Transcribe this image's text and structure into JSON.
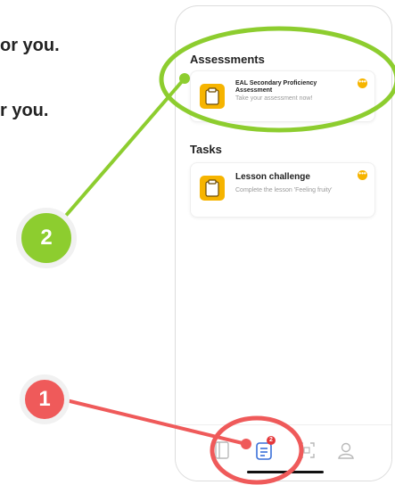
{
  "background": {
    "line1": "or you.",
    "line2": "r you."
  },
  "sections": {
    "assessments_title": "Assessments",
    "tasks_title": "Tasks"
  },
  "assessment_card": {
    "title": "EAL Secondary Proficiency Assessment",
    "subtitle": "Take your assessment now!",
    "more_icon": "ellipsis-icon"
  },
  "task_card": {
    "title": "Lesson challenge",
    "subtitle": "Complete the lesson 'Feeling fruity'",
    "more_icon": "ellipsis-icon"
  },
  "tabbar": {
    "tasks_badge": "2",
    "icons": [
      "book-icon",
      "tasks-icon",
      "scan-icon",
      "profile-icon"
    ]
  },
  "callouts": {
    "one": "1",
    "two": "2"
  },
  "colors": {
    "accent_yellow": "#f6b400",
    "callout_red": "#ef5a5a",
    "callout_green": "#8dcd2f",
    "tab_active": "#3a6fd8",
    "badge_red": "#e5383b"
  }
}
